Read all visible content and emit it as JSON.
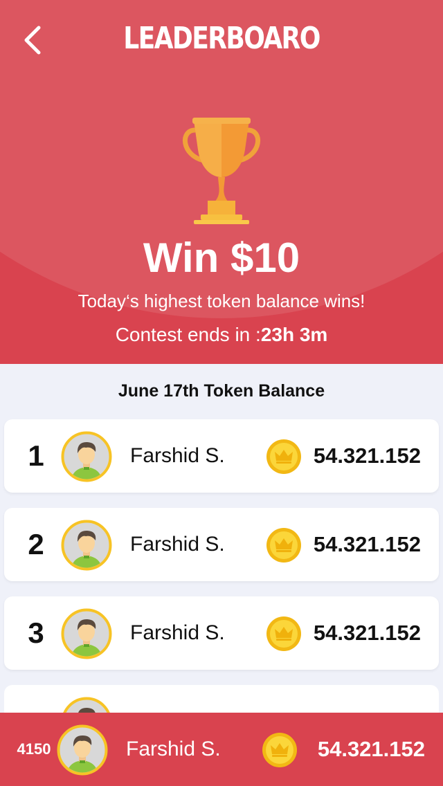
{
  "header": {
    "title": "LEADERBOARO",
    "back_icon": "chevron-left-icon",
    "trophy_icon": "trophy-icon",
    "prize": "Win $10",
    "subtitle": "Today‘s highest token balance wins!",
    "contest_label": "Contest ends in :",
    "contest_time": "23h 3m"
  },
  "leaderboard": {
    "section_title": "June 17th Token Balance",
    "rows": [
      {
        "rank": "1",
        "name": "Farshid S.",
        "balance": "54.321.152"
      },
      {
        "rank": "2",
        "name": "Farshid S.",
        "balance": "54.321.152"
      },
      {
        "rank": "3",
        "name": "Farshid S.",
        "balance": "54.321.152"
      }
    ]
  },
  "current_user": {
    "rank": "4150",
    "name": "Farshid S.",
    "balance": "54.321.152"
  },
  "colors": {
    "header_red": "#d9434f",
    "header_arc": "#dc5660",
    "background": "#eff1f9",
    "coin_gold": "#f7c325",
    "avatar_ring": "#f7c325"
  },
  "icons": {
    "coin": "crown-coin-icon",
    "avatar": "user-avatar-icon"
  }
}
